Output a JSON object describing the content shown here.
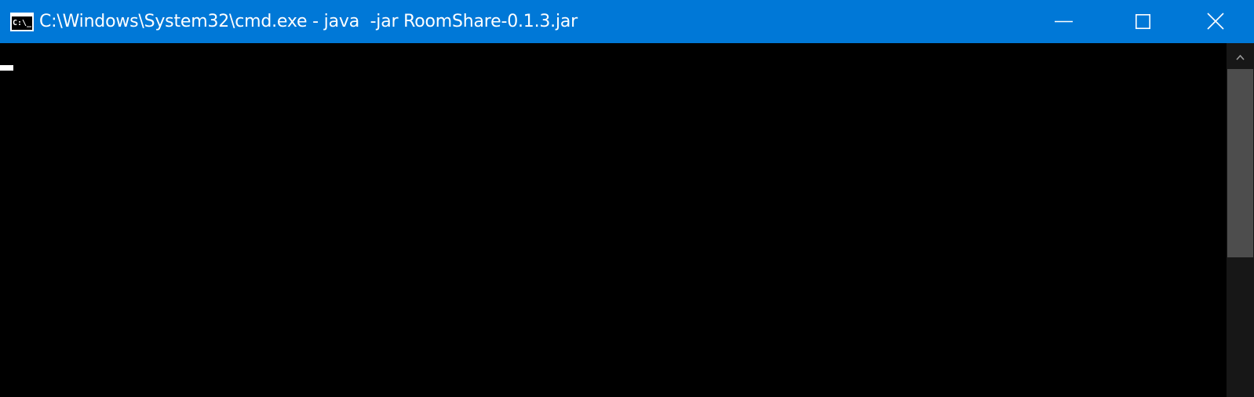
{
  "window": {
    "title": "C:\\Windows\\System32\\cmd.exe - java  -jar RoomShare-0.1.3.jar",
    "icon": "command-prompt-icon",
    "icon_text": "C:\\_",
    "controls": [
      "minimize-icon",
      "maximize-icon",
      "close-icon"
    ],
    "accent_color": "#0078d7"
  },
  "console": {
    "background_color": "#000000",
    "cursor_color": "#ffffff"
  },
  "scrollbar": {
    "up_icon": "chevron-up-icon",
    "position": 0.0
  }
}
